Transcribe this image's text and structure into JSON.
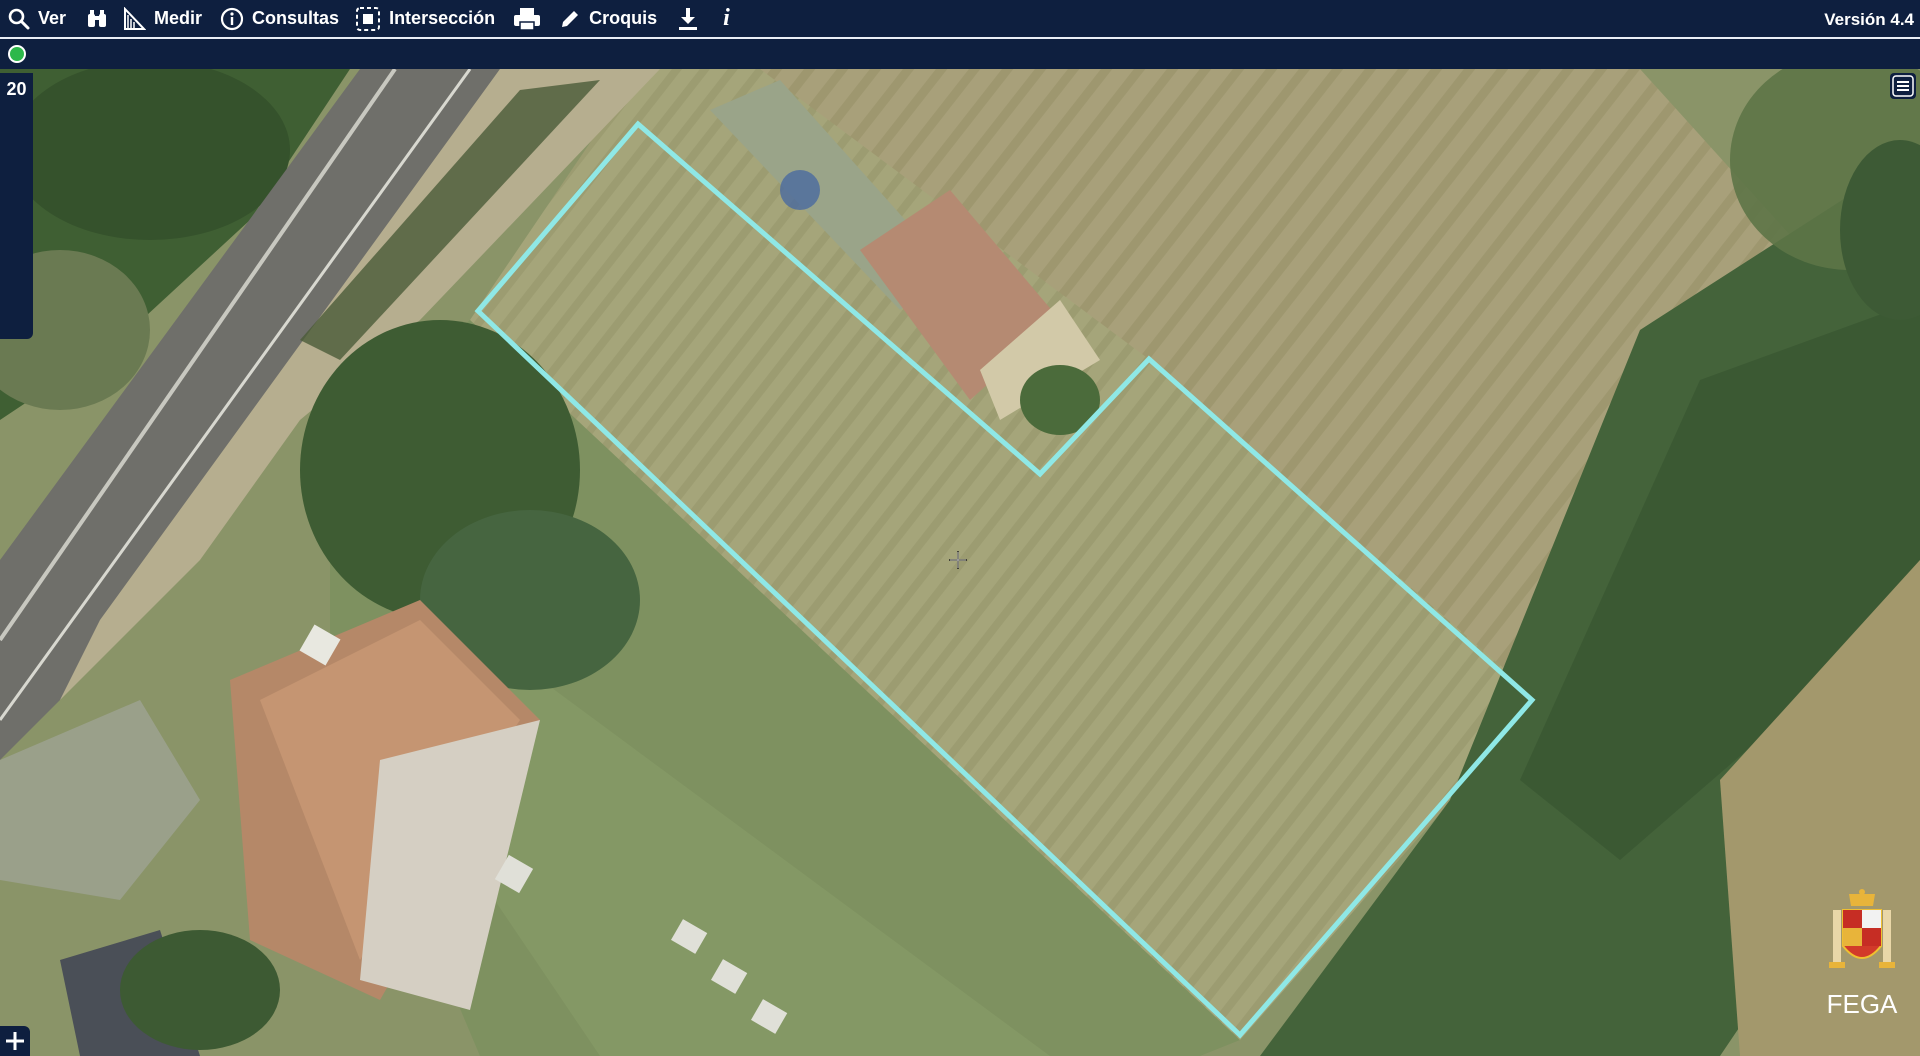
{
  "toolbar": {
    "ver_label": "Ver",
    "medir_label": "Medir",
    "consultas_label": "Consultas",
    "interseccion_label": "Intersección",
    "croquis_label": "Croquis",
    "info_label": "i",
    "version": "Versión 4.4"
  },
  "map": {
    "zoom_level": "20",
    "attribution": "FEGA",
    "parcel_outline_color": "#8fe8e6"
  },
  "colors": {
    "toolbar_bg": "#0e1f3f",
    "status_ok": "#2db84a",
    "text": "#ffffff"
  }
}
